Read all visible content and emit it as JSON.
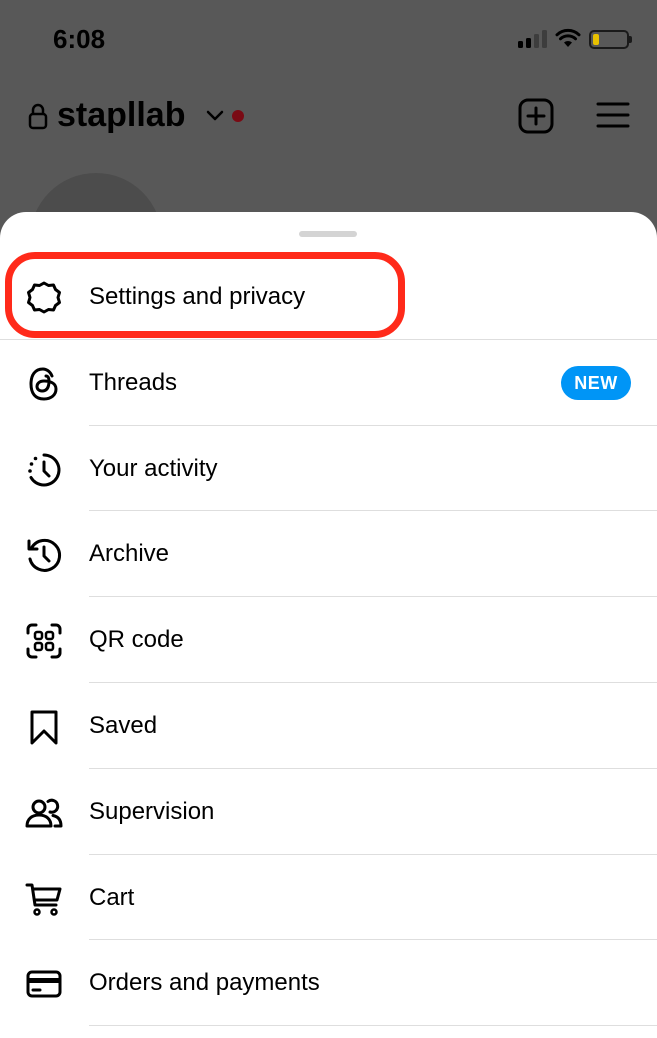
{
  "status_bar": {
    "time": "6:08",
    "battery_level": 0.2,
    "battery_color": "#e8c100",
    "signal_bars_active": 2,
    "icons": [
      "cellular-signal-icon",
      "wifi-icon",
      "battery-icon"
    ]
  },
  "header": {
    "username": "stapllab",
    "icons": [
      "lock-icon",
      "chevron-down-icon",
      "notification-dot",
      "create-post-icon",
      "hamburger-menu-icon"
    ],
    "notification_dot_color": "#7a0a14"
  },
  "sheet": {
    "items": [
      {
        "label": "Settings and privacy",
        "icon": "gear-icon"
      },
      {
        "label": "Threads",
        "icon": "threads-icon",
        "badge": "NEW"
      },
      {
        "label": "Your activity",
        "icon": "activity-clock-icon"
      },
      {
        "label": "Archive",
        "icon": "archive-history-icon"
      },
      {
        "label": "QR code",
        "icon": "qr-code-icon"
      },
      {
        "label": "Saved",
        "icon": "bookmark-icon"
      },
      {
        "label": "Supervision",
        "icon": "supervision-people-icon"
      },
      {
        "label": "Cart",
        "icon": "cart-icon"
      },
      {
        "label": "Orders and payments",
        "icon": "card-icon"
      }
    ],
    "badge_color": "#0095f6",
    "highlight_color": "#ff2a1a",
    "highlighted_item": "Settings and privacy"
  }
}
